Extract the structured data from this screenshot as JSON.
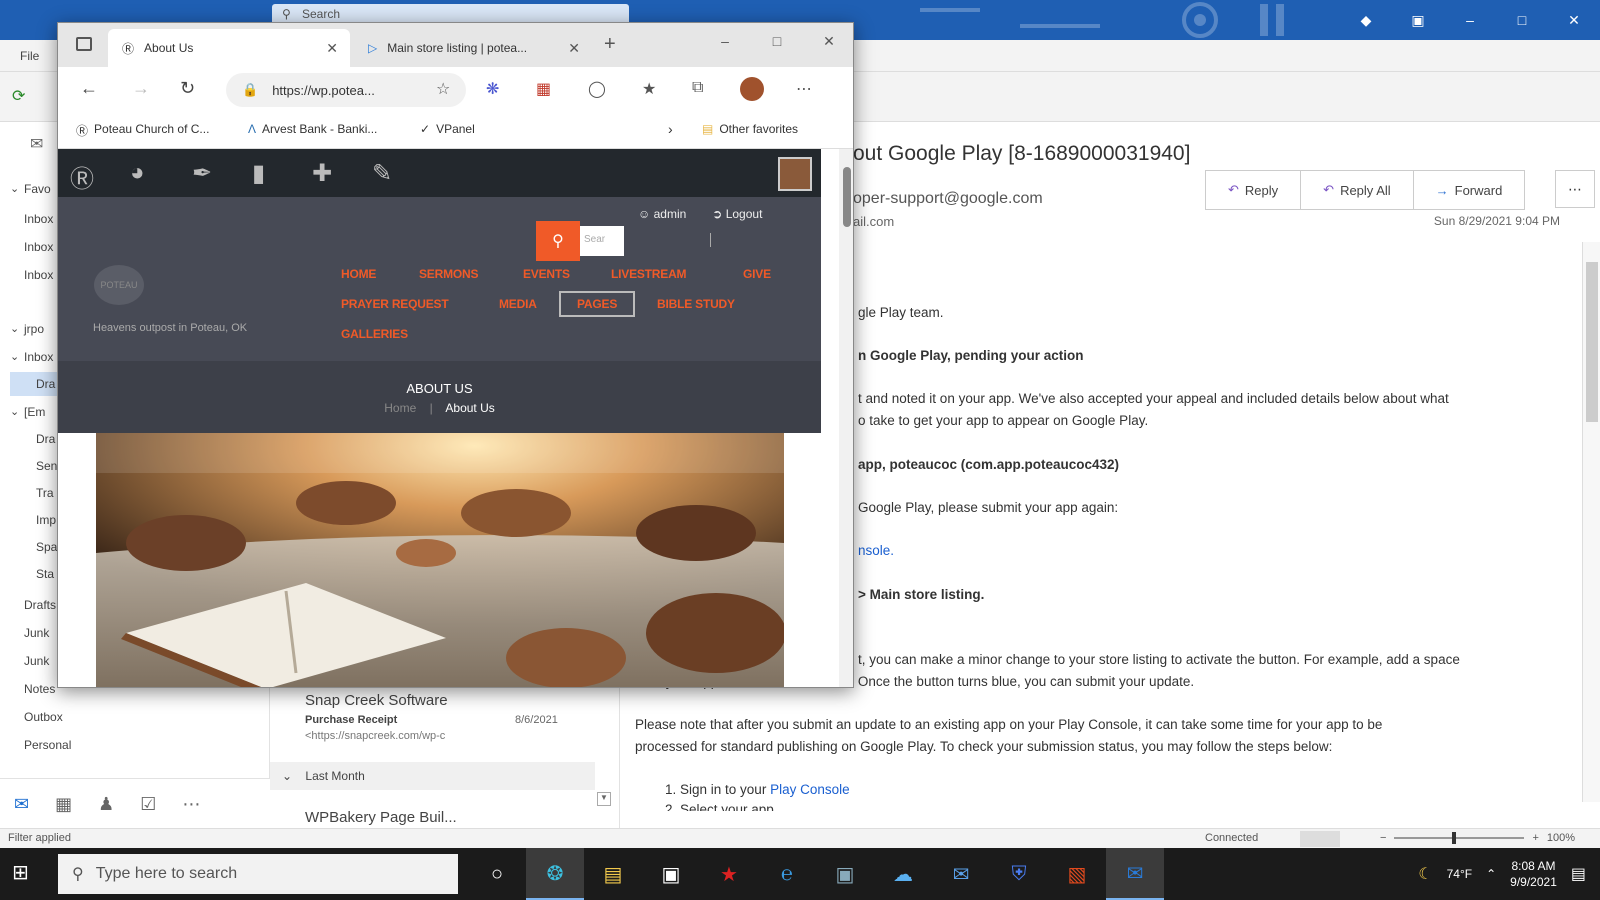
{
  "outlook": {
    "search_placeholder": "Search",
    "menu_file": "File",
    "win_controls": [
      "◆",
      "▣",
      "–",
      "□",
      "✕"
    ],
    "nav_items": [
      "Favo",
      "Inbox",
      "Inbox",
      "Inbox",
      "jrpo",
      "Inbox",
      "Dra",
      "[Em",
      "Dra",
      "Sen",
      "Tra",
      "Imp",
      "Spa",
      "Sta",
      "Drafts",
      "Junk",
      "Junk",
      "Notes",
      "Outbox",
      "Personal"
    ],
    "list": {
      "item1_sender": "Snap Creek Software",
      "item1_subject": "Purchase Receipt",
      "item1_date": "8/6/2021",
      "item1_preview": "<https://snapcreek.com/wp-c",
      "group_label": "Last Month",
      "item2_sender": "WPBakery Page Buil..."
    },
    "reading": {
      "subject": "out Google Play [8-1689000031940]",
      "from": "oper-support@google.com",
      "to": "ail.com",
      "date": "Sun 8/29/2021 9:04 PM",
      "reply": "Reply",
      "reply_all": "Reply All",
      "forward": "Forward",
      "more": "⋯",
      "body": {
        "l1": "gle Play team.",
        "l2": "n Google Play, pending your action",
        "l3": "t and noted it on your app. We've also accepted your appeal and included details below about what",
        "l4": "o take to get your app  to appear on Google Play.",
        "l5": "app, poteaucoc (com.app.poteaucoc432)",
        "l6": "Google Play, please submit your app again:",
        "l7": "nsole.",
        "l8": "> Main store listing.",
        "l9": "t, you can make a minor change to your store listing to activate the button. For example, add a space",
        "l10": "after your app title and then delete it. Once the button turns blue, you can submit your update.",
        "l11": "Please note that after you submit an update to an existing app on your Play Console, it can take some time for your app to be",
        "l12": "processed for standard publishing on Google Play. To check your submission status, you may follow the steps below:",
        "l13_prefix": "1.   Sign in to your ",
        "l13_link": "Play Console",
        "l14": "2.   Select your app."
      }
    },
    "status": {
      "left": "Filter applied",
      "connection": "Connected",
      "zoom": "100%"
    }
  },
  "taskbar": {
    "search_placeholder": "Type here to search",
    "weather": "74°F",
    "time": "8:08 AM",
    "date": "9/9/2021"
  },
  "browser": {
    "tab1_title": "About Us",
    "tab2_title": "Main store listing | potea...",
    "url": "https://wp.potea...",
    "bookmarks": [
      "Poteau Church of C...",
      "Arvest Bank - Banki...",
      "VPanel"
    ],
    "other_favorites": "Other favorites"
  },
  "site": {
    "admin_user": "admin",
    "logout": "Logout",
    "search_placeholder": "Sear",
    "tagline": "Heavens outpost in Poteau, OK",
    "logo_text": "POTEAU",
    "nav": {
      "home": "HOME",
      "sermons": "SERMONS",
      "events": "EVENTS",
      "livestream": "LIVESTREAM",
      "give": "GIVE",
      "prayer": "PRAYER REQUEST",
      "media": "MEDIA",
      "pages": "PAGES",
      "bible": "BIBLE STUDY",
      "galleries": "GALLERIES"
    },
    "page_title": "ABOUT US",
    "crumb_home": "Home",
    "crumb_sep": "|",
    "crumb_current": "About Us"
  }
}
